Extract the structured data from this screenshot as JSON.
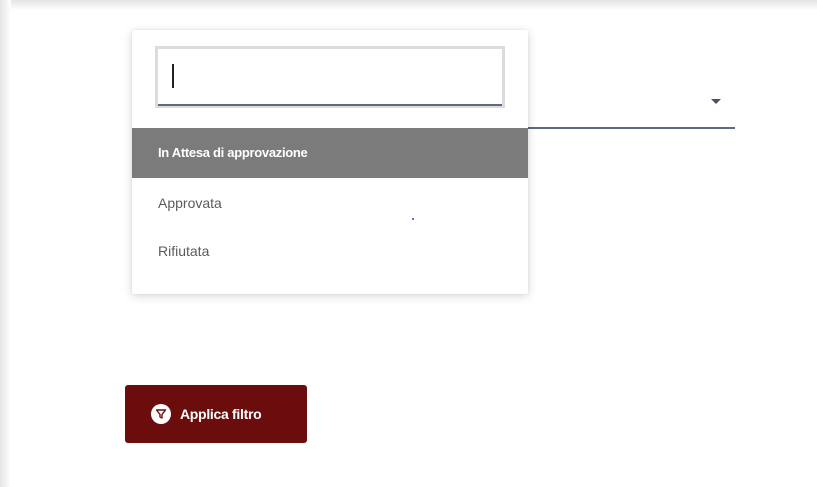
{
  "status_filter": {
    "search": {
      "value": "",
      "placeholder": ""
    },
    "options": [
      {
        "label": "In Attesa di approvazione",
        "selected": true
      },
      {
        "label": "Approvata",
        "selected": false
      },
      {
        "label": "Rifiutata",
        "selected": false
      }
    ]
  },
  "apply_button": {
    "label": "Applica filtro",
    "icon": "filter-icon",
    "color": "#6b0d0d"
  },
  "colors": {
    "selected_option_bg": "#7b7b7b",
    "underline": "#5a6b82"
  }
}
